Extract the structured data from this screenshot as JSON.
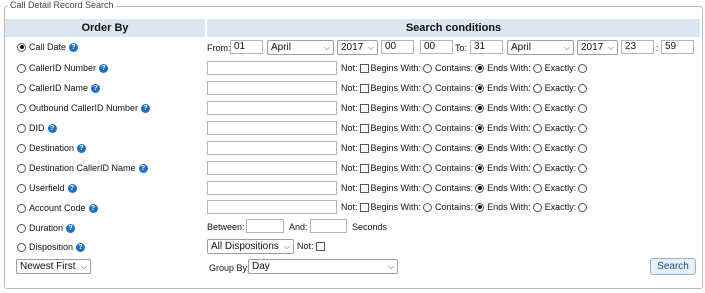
{
  "section_title": "Call Detail Record Search",
  "headers": {
    "order_by": "Order By",
    "search_conditions": "Search conditions"
  },
  "order_fields": [
    {
      "label": "Call Date",
      "selected": true
    },
    {
      "label": "CallerID Number",
      "selected": false
    },
    {
      "label": "CallerID Name",
      "selected": false
    },
    {
      "label": "Outbound CallerID Number",
      "selected": false
    },
    {
      "label": "DID",
      "selected": false
    },
    {
      "label": "Destination",
      "selected": false
    },
    {
      "label": "Destination CallerID Name",
      "selected": false
    },
    {
      "label": "Userfield",
      "selected": false
    },
    {
      "label": "Account Code",
      "selected": false
    },
    {
      "label": "Duration",
      "selected": false
    },
    {
      "label": "Disposition",
      "selected": false
    }
  ],
  "date_range": {
    "from_label": "From:",
    "from_day": "01",
    "from_month": "April",
    "from_year": "2017",
    "from_hour": "00",
    "from_minute": "00",
    "to_label": "To:",
    "to_day": "31",
    "to_month": "April",
    "to_year": "2017",
    "to_hour": "23",
    "to_minute": "59",
    "colon": ":"
  },
  "match_labels": {
    "not": "Not:",
    "begins": "Begins With:",
    "contains": "Contains:",
    "ends": "Ends With:",
    "exactly": "Exactly:"
  },
  "duration": {
    "between_label": "Between:",
    "and_label": "And:",
    "seconds_label": "Seconds"
  },
  "disposition": {
    "value": "All Dispositions",
    "not_label": "Not:"
  },
  "sort_order": "Newest First",
  "group_by": {
    "label": "Group By:",
    "value": "Day"
  },
  "search_button": "Search"
}
